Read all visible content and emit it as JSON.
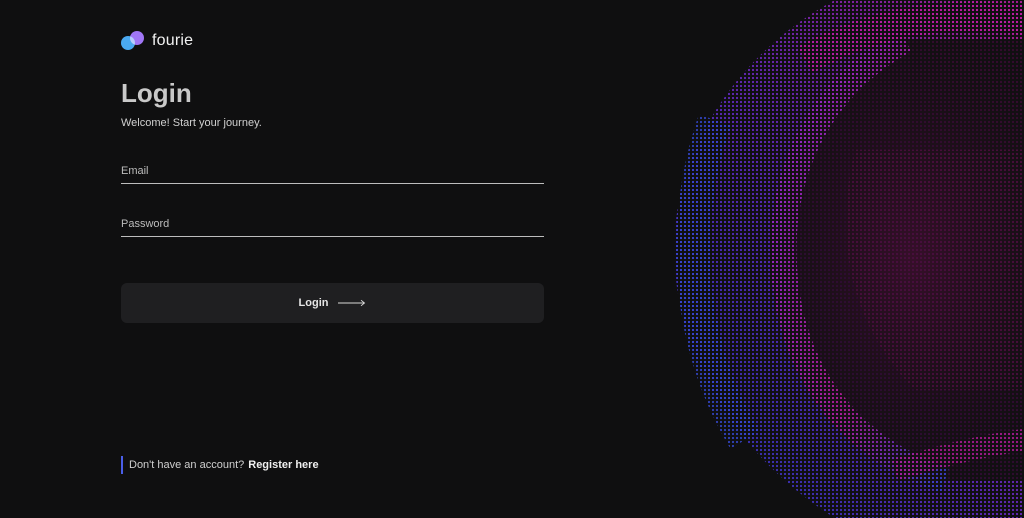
{
  "brand": {
    "name": "fourie",
    "logo_icon": "overlapping-circles-icon",
    "colors": {
      "circle_left": "#4aa9f0",
      "circle_right": "#9a6df5"
    }
  },
  "login": {
    "title": "Login",
    "subtitle": "Welcome! Start your journey.",
    "email_placeholder": "Email",
    "password_placeholder": "Password",
    "button_label": "Login",
    "button_icon": "arrow-right-icon"
  },
  "register": {
    "prompt": "Don't have an account?",
    "link_label": "Register here"
  },
  "theme": {
    "background": "#0f0f10",
    "button_bg": "#1f1f21",
    "accent_blue": "#4a5ee8",
    "accent_magenta": "#d01fb4",
    "accent_purple": "#7a2ee0"
  }
}
